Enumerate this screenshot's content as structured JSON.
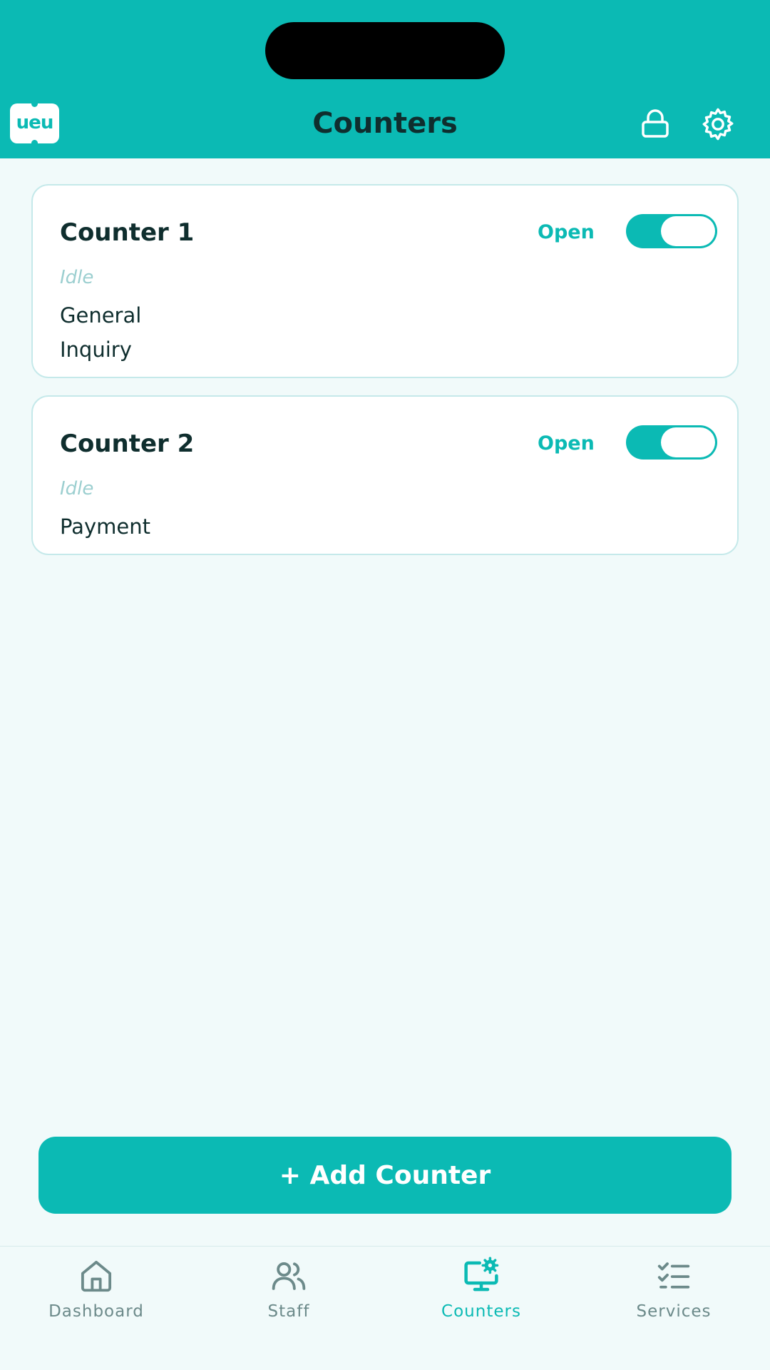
{
  "header": {
    "title": "Counters",
    "logo_text": "ueu",
    "logo_icon": "ueu-logo",
    "lock_icon": "lock-icon",
    "settings_icon": "gear-icon"
  },
  "counters": [
    {
      "name": "Counter 1",
      "state_label": "Open",
      "is_open": true,
      "status": "Idle",
      "services": [
        "General",
        "Inquiry"
      ]
    },
    {
      "name": "Counter 2",
      "state_label": "Open",
      "is_open": true,
      "status": "Idle",
      "services": [
        "Payment"
      ]
    }
  ],
  "add_button": {
    "label": "+ Add Counter"
  },
  "nav": {
    "active": "Counters",
    "items": [
      {
        "label": "Dashboard",
        "icon": "home-icon"
      },
      {
        "label": "Staff",
        "icon": "users-icon"
      },
      {
        "label": "Counters",
        "icon": "monitor-gear-icon"
      },
      {
        "label": "Services",
        "icon": "checklist-icon"
      }
    ]
  },
  "colors": {
    "accent": "#0bbab4",
    "background": "#f1fafa",
    "text_dark": "#0f2e2e",
    "status_muted": "#9ccfd0",
    "nav_inactive": "#6c8a8a"
  }
}
